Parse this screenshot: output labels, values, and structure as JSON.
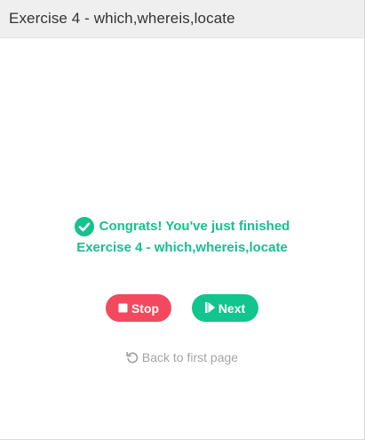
{
  "header": {
    "title": "Exercise 4 - which,whereis,locate"
  },
  "congrats": {
    "line1": "Congrats! You've just finished",
    "line2": "Exercise 4 - which,whereis,locate",
    "icon": "check-circle-icon"
  },
  "buttons": {
    "stop_label": "Stop",
    "stop_icon": "stop-icon",
    "next_label": "Next",
    "next_icon": "step-forward-icon"
  },
  "back": {
    "label": "Back to first page",
    "icon": "undo-icon"
  },
  "colors": {
    "accent_green": "#17c08f",
    "stop_red": "#f4485e",
    "next_green": "#12c48e",
    "muted_gray": "#a4a4a4",
    "header_bg": "#efeff0"
  }
}
